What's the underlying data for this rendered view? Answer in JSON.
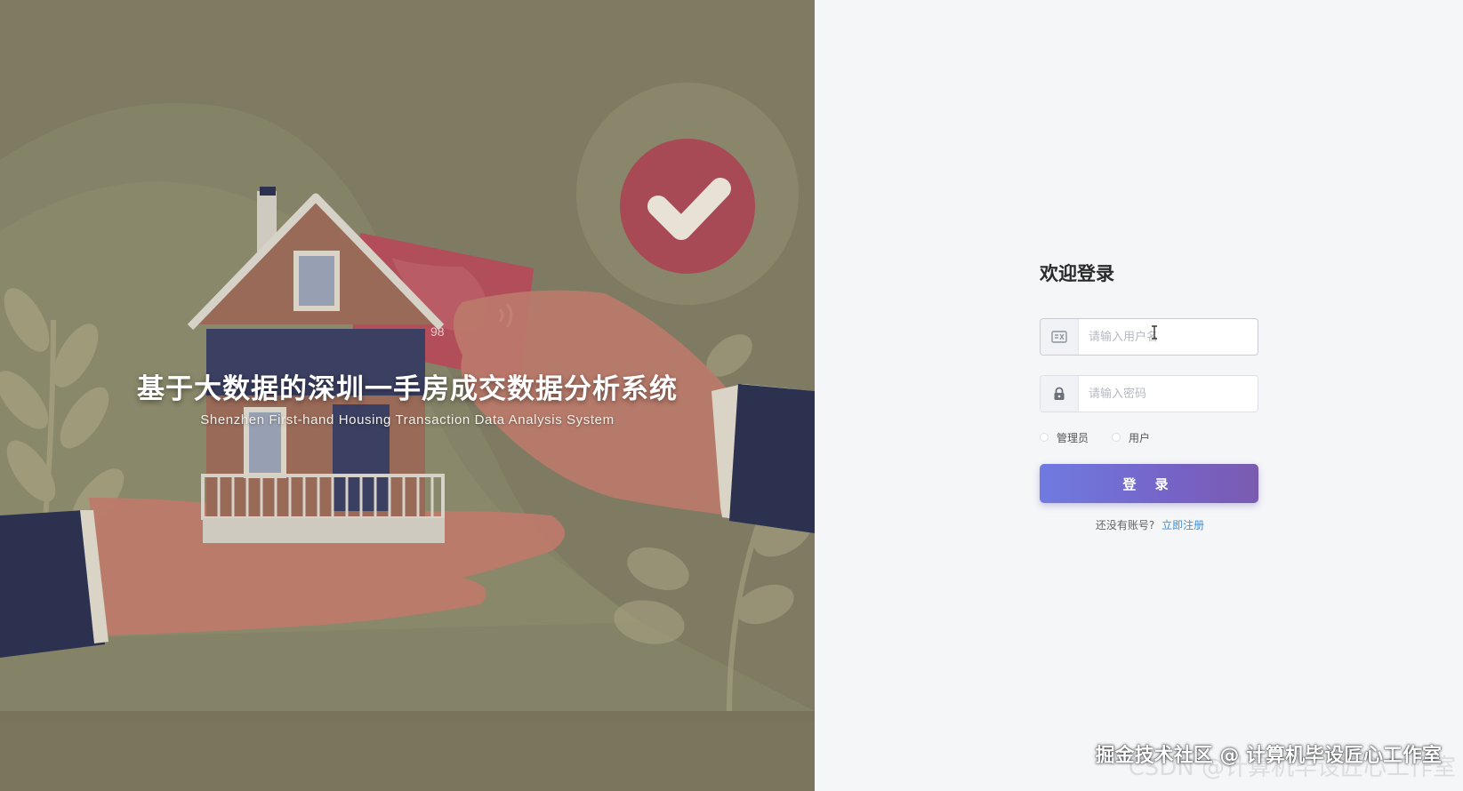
{
  "hero": {
    "title": "基于大数据的深圳一手房成交数据分析系统",
    "subtitle": "Shenzhen First-hand Housing Transaction Data Analysis System",
    "card_digits": "98",
    "colors": {
      "background": "#7f7a62",
      "accent_red": "#b04a55",
      "sleeve": "#2d3150"
    }
  },
  "login": {
    "heading": "欢迎登录",
    "username": {
      "placeholder": "请输入用户名",
      "value": "",
      "icon": "id-card-icon"
    },
    "password": {
      "placeholder": "请输入密码",
      "value": "",
      "icon": "lock-icon"
    },
    "roles": [
      {
        "label": "管理员",
        "selected": false
      },
      {
        "label": "用户",
        "selected": false
      }
    ],
    "submit_label": "登 录",
    "register_prompt": "还没有账号?",
    "register_link": "立即注册",
    "colors": {
      "button_start": "#6f7be0",
      "button_end": "#7a5bb0",
      "link": "#3f8fd8"
    }
  },
  "watermark": {
    "front": "掘金技术社区 @ 计算机毕设匠心工作室",
    "back": "CSDN @计算机毕设匠心工作室"
  }
}
